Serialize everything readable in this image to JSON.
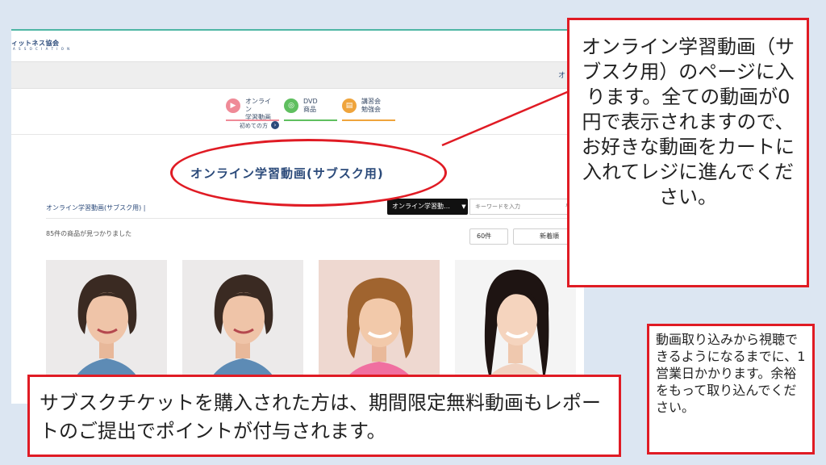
{
  "site": {
    "logo_text": "ィットネス協会",
    "logo_sub": "A S S O C I A T I O N",
    "graybar_text": "オ"
  },
  "nav": {
    "tabs": [
      {
        "line1": "オンライン",
        "line2": "学習動画",
        "icon": "video-icon",
        "color": "#ef8a97"
      },
      {
        "line1": "DVD",
        "line2": "商品",
        "icon": "disc-icon",
        "color": "#5fbf5f"
      },
      {
        "line1": "講習会",
        "line2": "勉強会",
        "icon": "book-icon",
        "color": "#efa43c"
      }
    ],
    "first_time": "初めての方",
    "first_time_icon": "›"
  },
  "page": {
    "title": "オンライン学習動画(サブスク用)",
    "breadcrumb": "オンライン学習動画(サブスク用) |",
    "category_select": "オンライン学習動…",
    "keyword_placeholder": "キーワードを入力",
    "result_count": "85件の商品が見つかりました",
    "per_page": "60件",
    "sort": "新着順"
  },
  "callouts": {
    "right": "オンライン学習動画（サブスク用）のページに入ります。全ての動画が0円で表示されますので、お好きな動画をカートに入れてレジに進んでください。",
    "bottom": "サブスクチケットを購入された方は、期間限定無料動画もレポートのご提出でポイントが付与されます。",
    "small": "動画取り込みから視聴できるようになるまでに、1営業日かかります。余裕をもって取り込んでください。"
  },
  "colors": {
    "accent_red": "#e01b24",
    "brand_navy": "#2b4a7a",
    "background": "#dce6f2"
  }
}
